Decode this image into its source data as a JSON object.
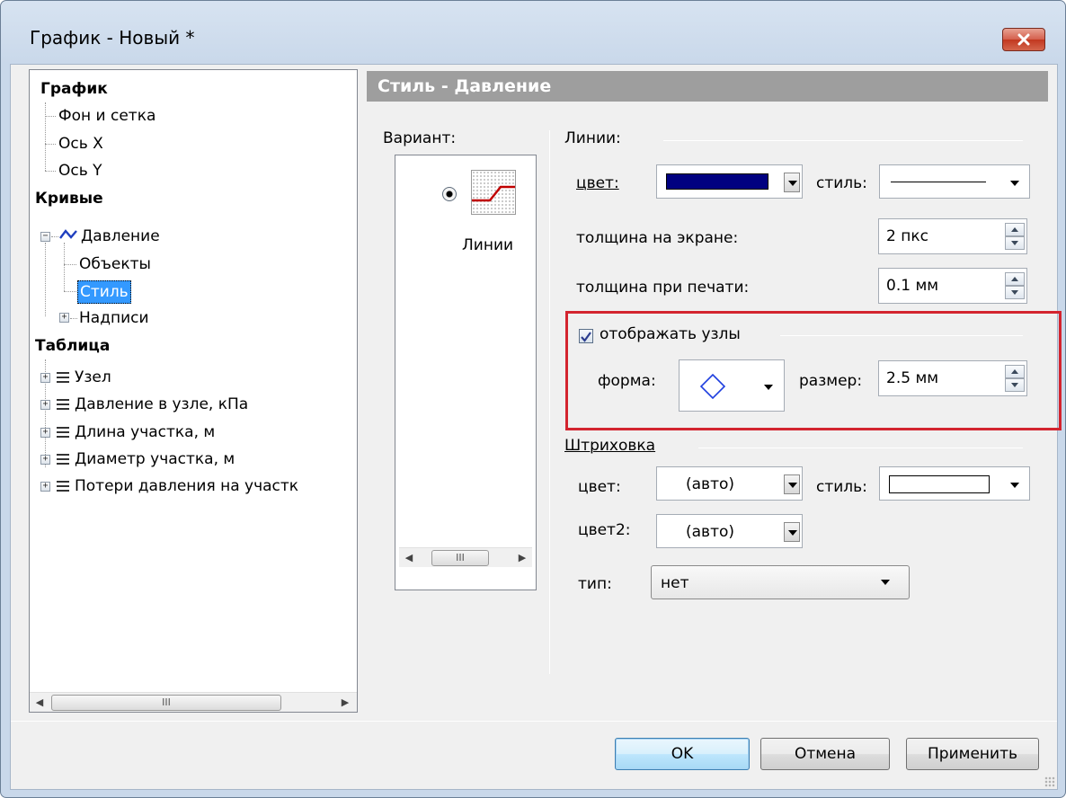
{
  "window": {
    "title": "График - Новый *"
  },
  "tree": {
    "items": [
      {
        "label": "График"
      },
      {
        "label": "Фон и сетка"
      },
      {
        "label": "Ось X"
      },
      {
        "label": "Ось Y"
      },
      {
        "label": "Кривые"
      },
      {
        "label": "Давление"
      },
      {
        "label": "Объекты"
      },
      {
        "label": "Стиль"
      },
      {
        "label": "Надписи"
      },
      {
        "label": "Таблица"
      },
      {
        "label": "Узел"
      },
      {
        "label": "Давление в узле, кПа"
      },
      {
        "label": "Длина участка, м"
      },
      {
        "label": "Диаметр участка, м"
      },
      {
        "label": "Потери давления на участк"
      }
    ],
    "scroll_thumb": "III"
  },
  "section": {
    "header": "Стиль - Давление"
  },
  "variant": {
    "label": "Вариант:",
    "option_label": "Линии",
    "scroll_thumb": "III",
    "accent_color": "#c00000"
  },
  "lines": {
    "group_label": "Линии:",
    "color_label": "цвет:",
    "color_value": "#000080",
    "style_label": "стиль:",
    "screen_thickness_label": "толщина на экране:",
    "screen_thickness_value": "2 пкс",
    "print_thickness_label": "толщина при печати:",
    "print_thickness_value": "0.1 мм"
  },
  "nodes": {
    "show_label": "отображать узлы",
    "checked": true,
    "shape_label": "форма:",
    "shape_icon": "diamond-icon",
    "size_label": "размер:",
    "size_value": "2.5 мм"
  },
  "hatch": {
    "group_label": "Штриховка",
    "color_label": "цвет:",
    "color_value": "(авто)",
    "style_label": "стиль:",
    "color2_label": "цвет2:",
    "color2_value": "(авто)",
    "type_label": "тип:",
    "type_value": "нет"
  },
  "buttons": {
    "ok": "OK",
    "cancel": "Отмена",
    "apply": "Применить"
  },
  "colors": {
    "header_bg": "#9e9e9e",
    "highlight_border": "#d3242f",
    "selection": "#3399ff"
  }
}
